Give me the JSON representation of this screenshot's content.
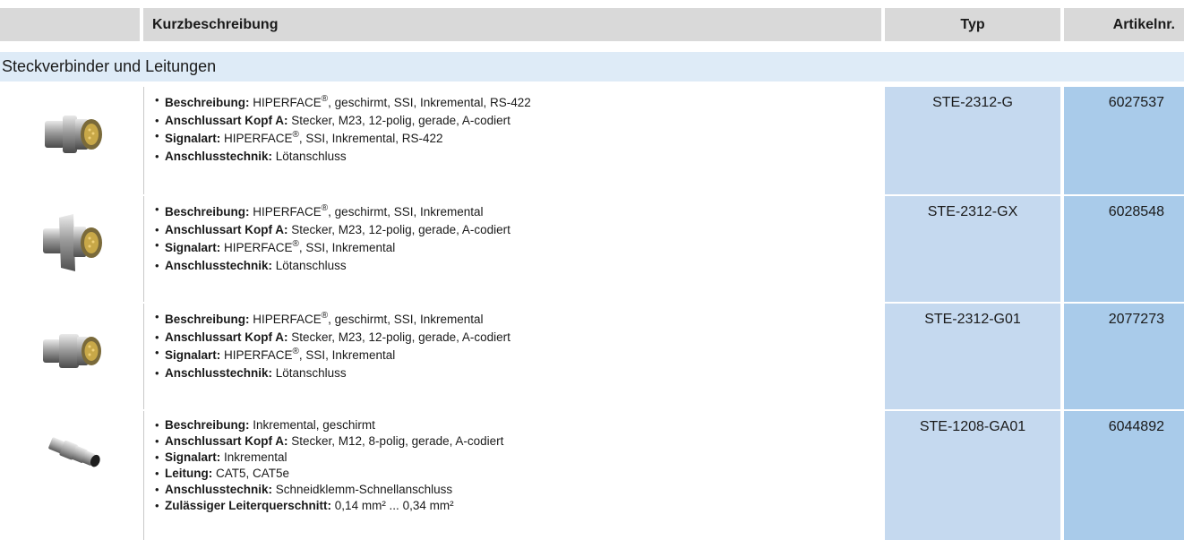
{
  "header": {
    "col_desc": "Kurzbeschreibung",
    "col_type": "Typ",
    "col_article": "Artikelnr."
  },
  "section": {
    "title": "Steckverbinder und Leitungen"
  },
  "rows": [
    {
      "image": "connector-m23-straight",
      "type": "STE-2312-G",
      "article": "6027537",
      "lines": [
        {
          "label": "Beschreibung:",
          "pre": " HIPERFACE",
          "sup": "®",
          "post": ", geschirmt, SSI, Inkremental, RS-422"
        },
        {
          "label": "Anschlussart Kopf A:",
          "pre": " Stecker, M23, 12-polig, gerade, A-codiert"
        },
        {
          "label": "Signalart:",
          "pre": " HIPERFACE",
          "sup": "®",
          "post": ", SSI, Inkremental, RS-422"
        },
        {
          "label": "Anschlusstechnik:",
          "pre": " Lötanschluss"
        }
      ]
    },
    {
      "image": "connector-m23-flange",
      "type": "STE-2312-GX",
      "article": "6028548",
      "lines": [
        {
          "label": "Beschreibung:",
          "pre": " HIPERFACE",
          "sup": "®",
          "post": ", geschirmt, SSI, Inkremental"
        },
        {
          "label": "Anschlussart Kopf A:",
          "pre": " Stecker, M23, 12-polig, gerade, A-codiert"
        },
        {
          "label": "Signalart:",
          "pre": " HIPERFACE",
          "sup": "®",
          "post": ", SSI, Inkremental"
        },
        {
          "label": "Anschlusstechnik:",
          "pre": " Lötanschluss"
        }
      ]
    },
    {
      "image": "connector-m23-straight-short",
      "type": "STE-2312-G01",
      "article": "2077273",
      "lines": [
        {
          "label": "Beschreibung:",
          "pre": " HIPERFACE",
          "sup": "®",
          "post": ", geschirmt, SSI, Inkremental"
        },
        {
          "label": "Anschlussart Kopf A:",
          "pre": " Stecker, M23, 12-polig, gerade, A-codiert"
        },
        {
          "label": "Signalart:",
          "pre": " HIPERFACE",
          "sup": "®",
          "post": ", SSI, Inkremental"
        },
        {
          "label": "Anschlusstechnik:",
          "pre": " Lötanschluss"
        }
      ]
    },
    {
      "image": "connector-m12",
      "type": "STE-1208-GA01",
      "article": "6044892",
      "lines": [
        {
          "label": "Beschreibung:",
          "pre": " Inkremental, geschirmt"
        },
        {
          "label": "Anschlussart Kopf A:",
          "pre": " Stecker, M12, 8-polig, gerade, A-codiert"
        },
        {
          "label": "Signalart:",
          "pre": " Inkremental"
        },
        {
          "label": "Leitung:",
          "pre": " CAT5, CAT5e"
        },
        {
          "label": "Anschlusstechnik:",
          "pre": " Schneidklemm-Schnellanschluss"
        },
        {
          "label": "Zulässiger Leiterquerschnitt:",
          "pre": " 0,14 mm² ... 0,34 mm²"
        }
      ]
    }
  ],
  "colors": {
    "header_bg": "#d9d9d9",
    "section_bg": "#deebf7",
    "type_col_bg": "#c5d9ef",
    "article_col_bg": "#a9cbea"
  }
}
